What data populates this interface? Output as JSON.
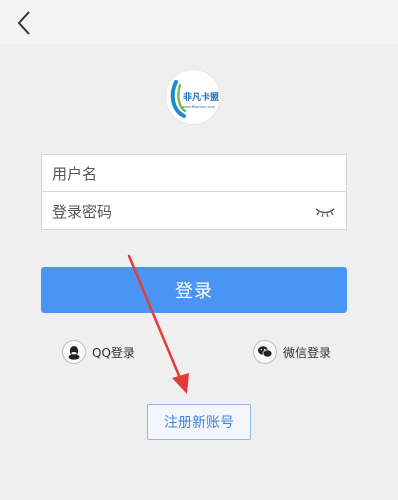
{
  "header": {
    "back_icon": "chevron-left-icon"
  },
  "logo": {
    "brand_text": "非凡卡盟",
    "url_text": "www.ffkamen.com"
  },
  "form": {
    "username_placeholder": "用户名",
    "password_placeholder": "登录密码",
    "eye_icon": "eye-closed-icon"
  },
  "actions": {
    "login_label": "登录",
    "qq_label": "QQ登录",
    "wechat_label": "微信登录",
    "register_label": "注册新账号"
  },
  "colors": {
    "primary": "#4a95f4",
    "register_border": "#8fb8ee",
    "register_text": "#3d84de",
    "annotation_arrow": "#e63b3b"
  }
}
